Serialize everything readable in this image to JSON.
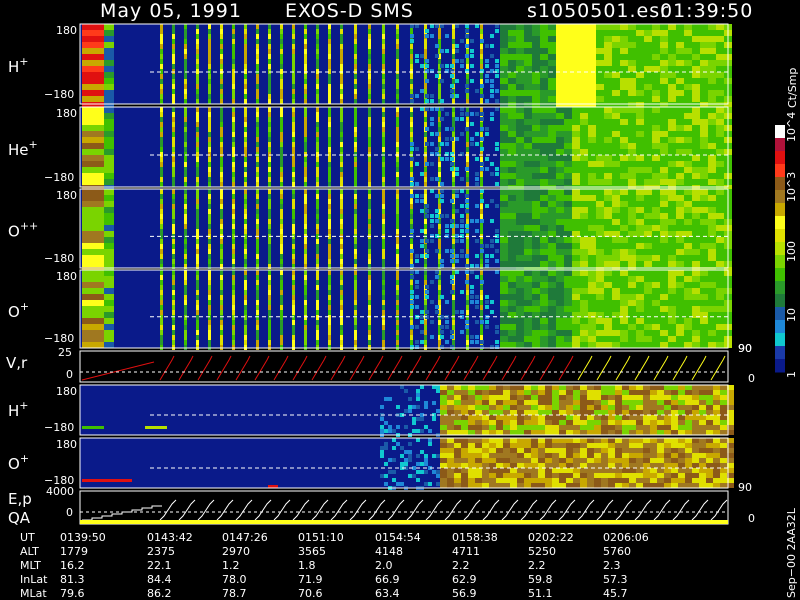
{
  "header": {
    "date": "May 05, 1991",
    "instrument": "EXOS-D SMS",
    "file": "s1050501.esr",
    "time": "01:39:50"
  },
  "colorbar": {
    "title": "Ct/Smp",
    "labels": [
      "10^4",
      "10^3",
      "100",
      "10",
      "1"
    ],
    "colors": [
      "#ffffff",
      "#b0123a",
      "#e01010",
      "#ff3a1a",
      "#8c5a18",
      "#a07820",
      "#c8a800",
      "#ffff1a",
      "#e0e000",
      "#b8e000",
      "#7ad400",
      "#40c000",
      "#2a9a2a",
      "#1f7a3a",
      "#1a5aa8",
      "#1e88d8",
      "#10c8d0",
      "#1a3aa8",
      "#0a1a8a"
    ]
  },
  "panels": [
    {
      "id": "h-plus",
      "species": "H",
      "charge": "+",
      "ytop": "180",
      "ybot": "−180"
    },
    {
      "id": "he-plus",
      "species": "He",
      "charge": "+",
      "ytop": "180",
      "ybot": "−180"
    },
    {
      "id": "o-plus-plus",
      "species": "O",
      "charge": "++",
      "ytop": "180",
      "ybot": "−180"
    },
    {
      "id": "o-plus",
      "species": "O",
      "charge": "+",
      "ytop": "180",
      "ybot": "−180"
    }
  ],
  "vr_panel": {
    "label": "V,r",
    "ytop": "25",
    "ymid": "0",
    "right_tick": "90"
  },
  "lower_panels": [
    {
      "id": "h-plus-2",
      "species": "H",
      "charge": "+",
      "ytop": "180",
      "ybot": "−180"
    },
    {
      "id": "o-plus-2",
      "species": "O",
      "charge": "+",
      "ytop": "180",
      "ybot": "−180",
      "right_tick": "90"
    }
  ],
  "ep_panel": {
    "label1": "E,p",
    "label2": "QA",
    "ytop": "4000",
    "ymid": "0",
    "right_tick": "0"
  },
  "right_scale": {
    "top": "90",
    "bottom": "0"
  },
  "footer_rows": [
    {
      "label": "UT",
      "values": [
        "0139:50",
        "0143:42",
        "0147:26",
        "0151:10",
        "0154:54",
        "0158:38",
        "0202:22",
        "0206:06"
      ]
    },
    {
      "label": "ALT",
      "values": [
        "1779",
        "2375",
        "2970",
        "3565",
        "4148",
        "4711",
        "5250",
        "5760"
      ]
    },
    {
      "label": "MLT",
      "values": [
        "16.2",
        "22.1",
        "1.2",
        "1.8",
        "2.0",
        "2.2",
        "2.2",
        "2.3"
      ]
    },
    {
      "label": "InLat",
      "values": [
        "81.3",
        "84.4",
        "78.0",
        "71.9",
        "66.9",
        "62.9",
        "59.8",
        "57.3"
      ]
    },
    {
      "label": "MLat",
      "values": [
        "79.6",
        "86.2",
        "78.7",
        "70.6",
        "63.4",
        "56.9",
        "51.1",
        "45.7"
      ]
    }
  ],
  "stamp": "Sep−00  2AA32L",
  "chart_data": {
    "type": "heatmap",
    "title": "May 05, 1991   EXOS-D SMS",
    "x_ticks": [
      "0139:50",
      "0143:42",
      "0147:26",
      "0151:10",
      "0154:54",
      "0158:38",
      "0202:22",
      "0206:06"
    ],
    "y_range": [
      -180,
      180
    ],
    "colorbar_range_log": [
      1,
      10000
    ],
    "colorbar_ticks": [
      "1",
      "10",
      "100",
      "10^3",
      "10^4"
    ]
  }
}
